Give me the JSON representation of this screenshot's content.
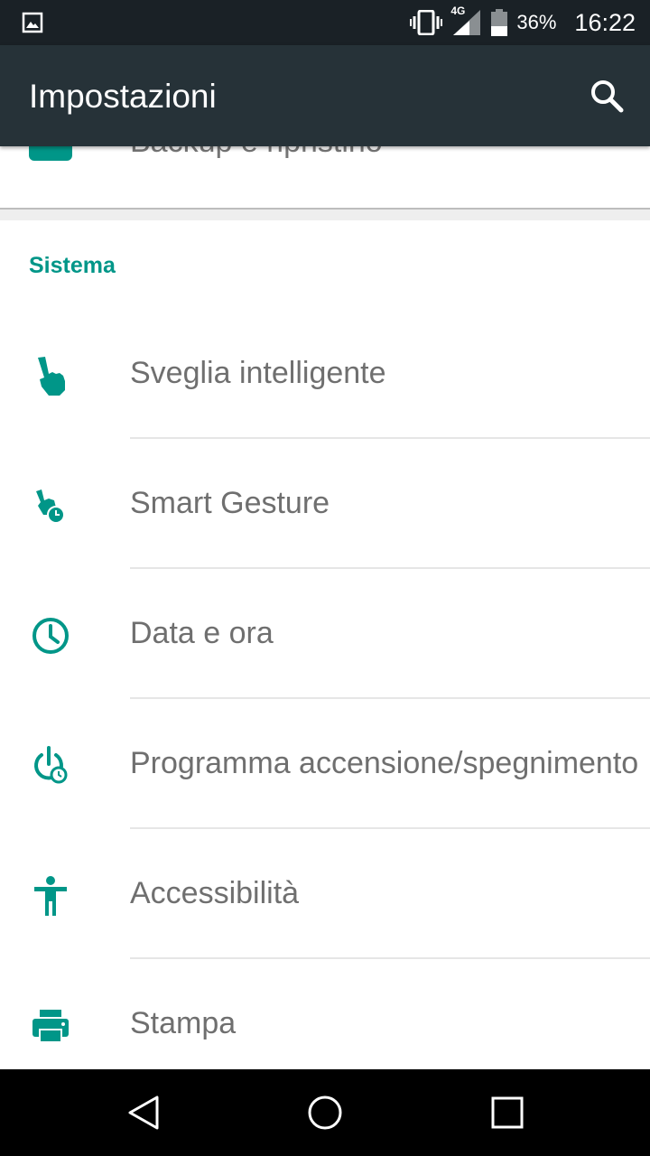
{
  "status_bar": {
    "network": "4G",
    "battery_percent": "36%",
    "time": "16:22",
    "icons": [
      "image-notification-icon",
      "vibrate-icon",
      "signal-icon",
      "battery-icon"
    ]
  },
  "app_bar": {
    "title": "Impostazioni",
    "search_icon": "search-icon"
  },
  "partial_item": {
    "label": "Backup e ripristino",
    "icon": "backup-icon"
  },
  "section": {
    "title": "Sistema",
    "items": [
      {
        "label": "Sveglia intelligente",
        "icon": "hand-pointer-icon"
      },
      {
        "label": "Smart Gesture",
        "icon": "gesture-clock-icon"
      },
      {
        "label": "Data e ora",
        "icon": "clock-icon"
      },
      {
        "label": "Programma accensione/spegnimento",
        "icon": "power-schedule-icon"
      },
      {
        "label": "Accessibilità",
        "icon": "accessibility-icon"
      },
      {
        "label": "Stampa",
        "icon": "printer-icon"
      }
    ]
  },
  "nav_bar": {
    "back_icon": "back-icon",
    "home_icon": "home-icon",
    "recents_icon": "recents-icon"
  },
  "colors": {
    "status_bar": "#1a2126",
    "app_bar": "#263238",
    "accent": "#009688",
    "label": "#6f6f6f"
  }
}
